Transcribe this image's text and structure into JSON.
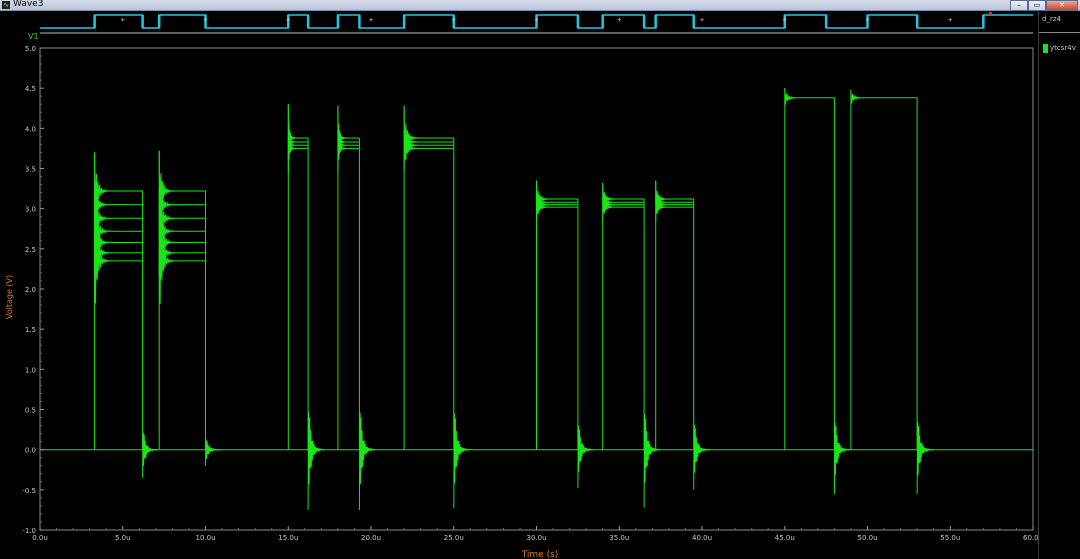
{
  "window": {
    "title": "Wave3",
    "buttons": [
      "minimize",
      "restore",
      "close"
    ]
  },
  "digital": {
    "name": "d_rz4",
    "color": "#1ec8e0",
    "edges": [
      3.3,
      6.2,
      7.2,
      10.0,
      15.0,
      16.2,
      18.0,
      19.3,
      22.0,
      25.0,
      30.0,
      32.5,
      34.0,
      36.5,
      37.2,
      39.5,
      45.0,
      47.5,
      50.0,
      53.0,
      57.0
    ],
    "initial_low": true
  },
  "plot": {
    "panel_label": "V1",
    "legend": "ytcsr4v"
  },
  "chart_data": {
    "type": "line",
    "xlabel": "Time (s)",
    "ylabel": "Voltage (V)",
    "xlim": [
      0,
      60
    ],
    "ylim": [
      -1.0,
      5.0
    ],
    "xtick_labels": [
      "0.0u",
      "5.0u",
      "10.0u",
      "15.0u",
      "20.0u",
      "25.0u",
      "30.0u",
      "35.0u",
      "40.0u",
      "45.0u",
      "50.0u",
      "55.0u",
      "60.0u"
    ],
    "ytick_labels": [
      "-1.0",
      "-0.5",
      "0.0",
      "0.5",
      "1.0",
      "1.5",
      "2.0",
      "2.5",
      "3.0",
      "3.5",
      "4.0",
      "4.5",
      "5.0"
    ],
    "series_color": "#19e619",
    "pulses": [
      {
        "start": 3.3,
        "end": 6.2,
        "overshoot": 3.7,
        "levels": [
          3.22,
          3.05,
          2.88,
          2.72,
          2.58,
          2.45,
          2.35
        ]
      },
      {
        "start": 7.2,
        "end": 10.0,
        "overshoot": 3.72,
        "levels": [
          3.22,
          3.05,
          2.88,
          2.72,
          2.58,
          2.45,
          2.35
        ]
      },
      {
        "start": 15.0,
        "end": 16.2,
        "overshoot": 4.3,
        "levels": [
          3.88,
          3.83,
          3.79,
          3.75
        ]
      },
      {
        "start": 18.0,
        "end": 19.3,
        "overshoot": 4.28,
        "levels": [
          3.88,
          3.83,
          3.79,
          3.75
        ]
      },
      {
        "start": 22.0,
        "end": 25.0,
        "overshoot": 4.28,
        "levels": [
          3.88,
          3.83,
          3.79,
          3.75
        ]
      },
      {
        "start": 30.0,
        "end": 32.5,
        "overshoot": 3.35,
        "levels": [
          3.12,
          3.08,
          3.05,
          3.02
        ]
      },
      {
        "start": 34.0,
        "end": 36.5,
        "overshoot": 3.32,
        "levels": [
          3.12,
          3.08,
          3.05,
          3.02
        ]
      },
      {
        "start": 37.2,
        "end": 39.5,
        "overshoot": 3.35,
        "levels": [
          3.12,
          3.08,
          3.05,
          3.02
        ]
      },
      {
        "start": 45.0,
        "end": 48.0,
        "overshoot": 4.5,
        "levels": [
          4.38
        ]
      },
      {
        "start": 49.0,
        "end": 53.0,
        "overshoot": 4.48,
        "levels": [
          4.38
        ]
      }
    ],
    "undershoot": [
      {
        "t": 6.2,
        "min": -0.35
      },
      {
        "t": 10.0,
        "min": -0.2
      },
      {
        "t": 16.2,
        "min": -0.75
      },
      {
        "t": 19.3,
        "min": -0.75
      },
      {
        "t": 25.0,
        "min": -0.73
      },
      {
        "t": 32.5,
        "min": -0.48
      },
      {
        "t": 36.5,
        "min": -0.72
      },
      {
        "t": 39.5,
        "min": -0.5
      },
      {
        "t": 48.0,
        "min": -0.55
      },
      {
        "t": 53.0,
        "min": -0.55
      }
    ],
    "end_time": 60.0
  }
}
